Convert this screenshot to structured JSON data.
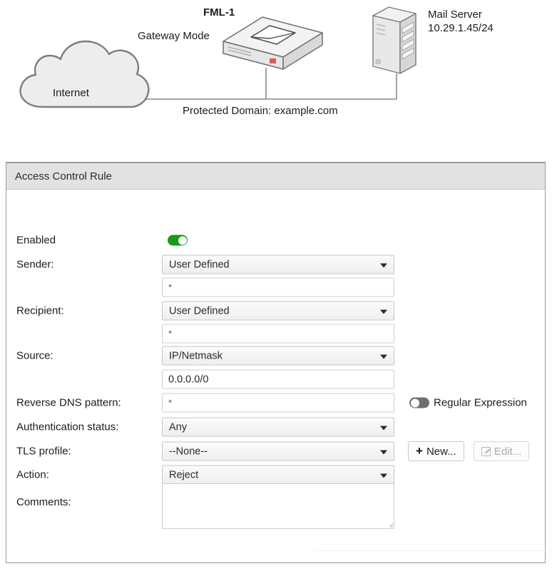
{
  "diagram": {
    "device_title": "FML-1",
    "device_mode": "Gateway Mode",
    "mail_server_name": "Mail Server",
    "mail_server_ip": "10.29.1.45/24",
    "cloud_label": "Internet",
    "domain_label": "Protected Domain: example.com"
  },
  "panel": {
    "title": "Access Control Rule",
    "rows": {
      "enabled": {
        "label": "Enabled",
        "toggle_state": "on"
      },
      "sender": {
        "label": "Sender:",
        "select_value": "User Defined",
        "text_value": "*"
      },
      "recipient": {
        "label": "Recipient:",
        "select_value": "User Defined",
        "text_value": "*"
      },
      "source": {
        "label": "Source:",
        "select_value": "IP/Netmask",
        "text_value": "0.0.0.0/0"
      },
      "reverse_dns": {
        "label": "Reverse DNS pattern:",
        "text_value": "*",
        "regex_toggle_label": "Regular Expression",
        "regex_toggle_state": "off"
      },
      "auth_status": {
        "label": "Authentication status:",
        "select_value": "Any"
      },
      "tls_profile": {
        "label": "TLS profile:",
        "select_value": "--None--",
        "new_button": "New...",
        "edit_button": "Edit..."
      },
      "action": {
        "label": "Action:",
        "select_value": "Reject"
      },
      "comments": {
        "label": "Comments:",
        "text_value": ""
      }
    }
  },
  "colors": {
    "toggle_on": "#169b16",
    "toggle_off": "#6f6f6f",
    "panel_header_bg": "#e2e2e2",
    "panel_border": "#9a9a9a",
    "diagram_shape_fill": "#ededed",
    "diagram_shape_stroke": "#7d7d7d"
  }
}
